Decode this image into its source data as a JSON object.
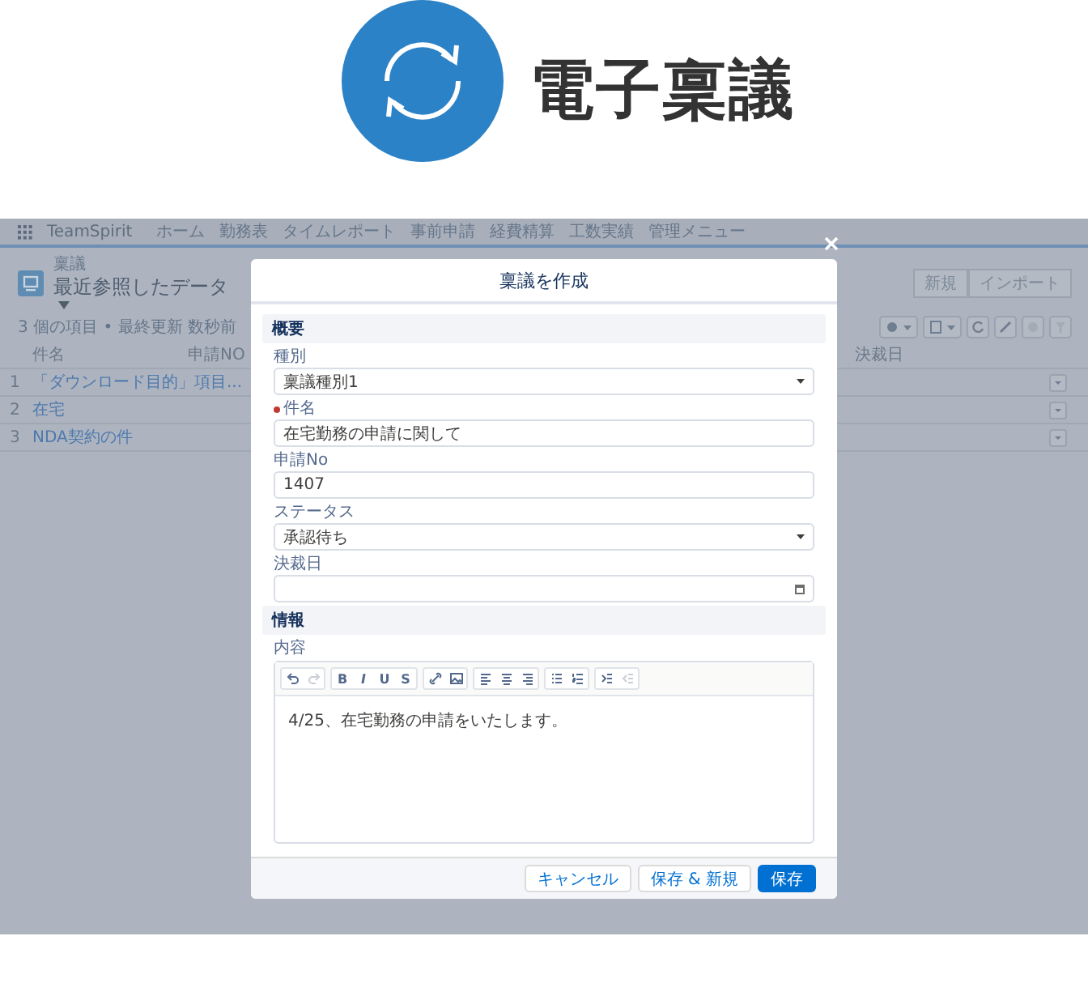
{
  "hero": {
    "title": "電子稟議"
  },
  "app": {
    "brand": "TeamSpirit",
    "nav": [
      "ホーム",
      "勤務表",
      "タイムレポート",
      "事前申請",
      "経費精算",
      "工数実績",
      "管理メニュー"
    ],
    "object_label": "稟議",
    "list_title": "最近参照したデータ",
    "meta": "3 個の項目 • 最終更新 数秒前",
    "header_buttons": [
      "新規",
      "インポート"
    ],
    "columns": [
      "件名",
      "申請NO",
      "決裁日"
    ],
    "rows": [
      {
        "num": "1",
        "name": "「ダウンロード目的」項目..."
      },
      {
        "num": "2",
        "name": "在宅"
      },
      {
        "num": "3",
        "name": "NDA契約の件"
      }
    ]
  },
  "modal": {
    "title": "稟議を作成",
    "sections": [
      {
        "title": "概要",
        "fields": [
          {
            "kind": "select",
            "label": "種別",
            "required": false,
            "value": "稟議種別1"
          },
          {
            "kind": "text",
            "label": "件名",
            "required": true,
            "value": "在宅勤務の申請に関して"
          },
          {
            "kind": "text",
            "label": "申請No",
            "required": false,
            "value": "1407"
          },
          {
            "kind": "select",
            "label": "ステータス",
            "required": false,
            "value": "承認待ち"
          },
          {
            "kind": "date",
            "label": "決裁日",
            "required": false
          }
        ]
      },
      {
        "title": "情報",
        "fields": [
          {
            "kind": "richtext",
            "label": "内容",
            "required": false,
            "value": "4/25、在宅勤務の申請をいたします。"
          }
        ]
      }
    ],
    "toolbar": [
      [
        {
          "kind": "undo",
          "disabled": false
        },
        {
          "kind": "redo",
          "disabled": true
        }
      ],
      [
        {
          "kind": "char",
          "label": "B",
          "disabled": false
        },
        {
          "kind": "char",
          "label": "I",
          "disabled": false
        },
        {
          "kind": "char",
          "label": "U",
          "disabled": false
        },
        {
          "kind": "char",
          "label": "S",
          "disabled": false
        }
      ],
      [
        {
          "kind": "link",
          "disabled": false
        },
        {
          "kind": "image",
          "disabled": false
        }
      ],
      [
        {
          "kind": "align-left",
          "disabled": false
        },
        {
          "kind": "align-center",
          "disabled": false
        },
        {
          "kind": "align-right",
          "disabled": false
        }
      ],
      [
        {
          "kind": "bullets",
          "disabled": false
        },
        {
          "kind": "numbers",
          "disabled": false
        }
      ],
      [
        {
          "kind": "indent",
          "disabled": false
        },
        {
          "kind": "outdent",
          "disabled": true
        }
      ]
    ],
    "buttons": [
      {
        "label": "キャンセル",
        "kind": "neutral"
      },
      {
        "label": "保存 & 新規",
        "kind": "neutral"
      },
      {
        "label": "保存",
        "kind": "brand"
      }
    ]
  }
}
